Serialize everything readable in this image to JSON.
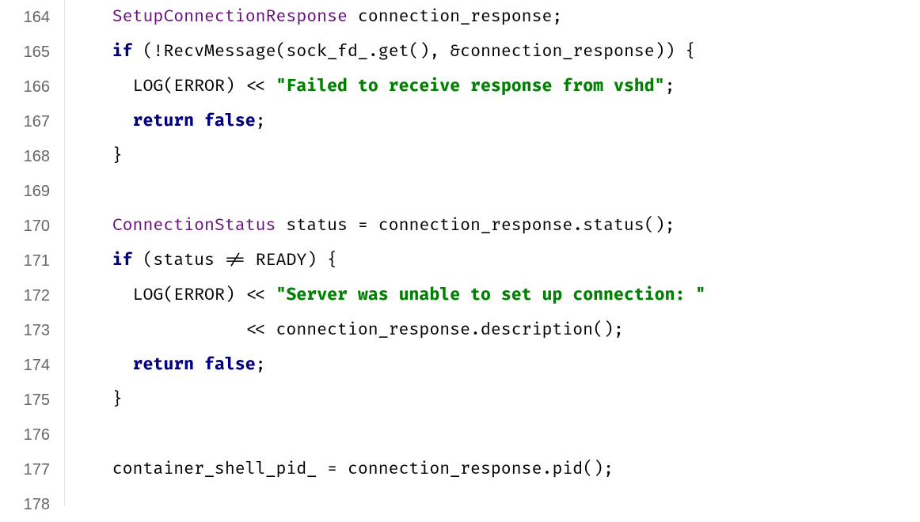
{
  "lines": [
    {
      "num": "164",
      "indent": 2,
      "tokens": [
        {
          "t": "SetupConnectionResponse",
          "c": "tk-type"
        },
        {
          "t": " ",
          "c": ""
        },
        {
          "t": "connection_response",
          "c": "tk-ident"
        },
        {
          "t": ";",
          "c": "tk-punct"
        }
      ]
    },
    {
      "num": "165",
      "indent": 2,
      "tokens": [
        {
          "t": "if",
          "c": "tk-kw"
        },
        {
          "t": " (!",
          "c": "tk-punct"
        },
        {
          "t": "RecvMessage",
          "c": "tk-func"
        },
        {
          "t": "(",
          "c": "tk-punct"
        },
        {
          "t": "sock_fd_",
          "c": "tk-ident"
        },
        {
          "t": ".",
          "c": "tk-punct"
        },
        {
          "t": "get",
          "c": "tk-func"
        },
        {
          "t": "(), &",
          "c": "tk-punct"
        },
        {
          "t": "connection_response",
          "c": "tk-ident"
        },
        {
          "t": ")) {",
          "c": "tk-punct"
        }
      ]
    },
    {
      "num": "166",
      "indent": 3,
      "tokens": [
        {
          "t": "LOG",
          "c": "tk-func"
        },
        {
          "t": "(",
          "c": "tk-punct"
        },
        {
          "t": "ERROR",
          "c": "tk-ident"
        },
        {
          "t": ") << ",
          "c": "tk-punct"
        },
        {
          "t": "\"Failed to receive response from vshd\"",
          "c": "tk-str"
        },
        {
          "t": ";",
          "c": "tk-punct"
        }
      ]
    },
    {
      "num": "167",
      "indent": 3,
      "tokens": [
        {
          "t": "return",
          "c": "tk-kw"
        },
        {
          "t": " ",
          "c": ""
        },
        {
          "t": "false",
          "c": "tk-false"
        },
        {
          "t": ";",
          "c": "tk-punct"
        }
      ]
    },
    {
      "num": "168",
      "indent": 2,
      "tokens": [
        {
          "t": "}",
          "c": "tk-punct"
        }
      ]
    },
    {
      "num": "169",
      "indent": 0,
      "tokens": []
    },
    {
      "num": "170",
      "indent": 2,
      "tokens": [
        {
          "t": "ConnectionStatus",
          "c": "tk-type"
        },
        {
          "t": " ",
          "c": ""
        },
        {
          "t": "status",
          "c": "tk-ident"
        },
        {
          "t": " = ",
          "c": "tk-punct"
        },
        {
          "t": "connection_response",
          "c": "tk-ident"
        },
        {
          "t": ".",
          "c": "tk-punct"
        },
        {
          "t": "status",
          "c": "tk-func"
        },
        {
          "t": "();",
          "c": "tk-punct"
        }
      ]
    },
    {
      "num": "171",
      "indent": 2,
      "tokens": [
        {
          "t": "if",
          "c": "tk-kw"
        },
        {
          "t": " (",
          "c": "tk-punct"
        },
        {
          "t": "status",
          "c": "tk-ident"
        },
        {
          "t": " != ",
          "c": "tk-punct"
        },
        {
          "t": "READY",
          "c": "tk-ident"
        },
        {
          "t": ") {",
          "c": "tk-punct"
        }
      ]
    },
    {
      "num": "172",
      "indent": 3,
      "tokens": [
        {
          "t": "LOG",
          "c": "tk-func"
        },
        {
          "t": "(",
          "c": "tk-punct"
        },
        {
          "t": "ERROR",
          "c": "tk-ident"
        },
        {
          "t": ") << ",
          "c": "tk-punct"
        },
        {
          "t": "\"Server was unable to set up connection: \"",
          "c": "tk-str"
        }
      ]
    },
    {
      "num": "173",
      "indent": 3,
      "tokens": [
        {
          "t": "           << ",
          "c": "tk-punct"
        },
        {
          "t": "connection_response",
          "c": "tk-ident"
        },
        {
          "t": ".",
          "c": "tk-punct"
        },
        {
          "t": "description",
          "c": "tk-func"
        },
        {
          "t": "();",
          "c": "tk-punct"
        }
      ]
    },
    {
      "num": "174",
      "indent": 3,
      "tokens": [
        {
          "t": "return",
          "c": "tk-kw"
        },
        {
          "t": " ",
          "c": ""
        },
        {
          "t": "false",
          "c": "tk-false"
        },
        {
          "t": ";",
          "c": "tk-punct"
        }
      ]
    },
    {
      "num": "175",
      "indent": 2,
      "tokens": [
        {
          "t": "}",
          "c": "tk-punct"
        }
      ]
    },
    {
      "num": "176",
      "indent": 0,
      "tokens": []
    },
    {
      "num": "177",
      "indent": 2,
      "tokens": [
        {
          "t": "container_shell_pid_",
          "c": "tk-ident"
        },
        {
          "t": " = ",
          "c": "tk-punct"
        },
        {
          "t": "connection_response",
          "c": "tk-ident"
        },
        {
          "t": ".",
          "c": "tk-punct"
        },
        {
          "t": "pid",
          "c": "tk-func"
        },
        {
          "t": "();",
          "c": "tk-punct"
        }
      ]
    },
    {
      "num": "178",
      "indent": 0,
      "tokens": []
    }
  ]
}
